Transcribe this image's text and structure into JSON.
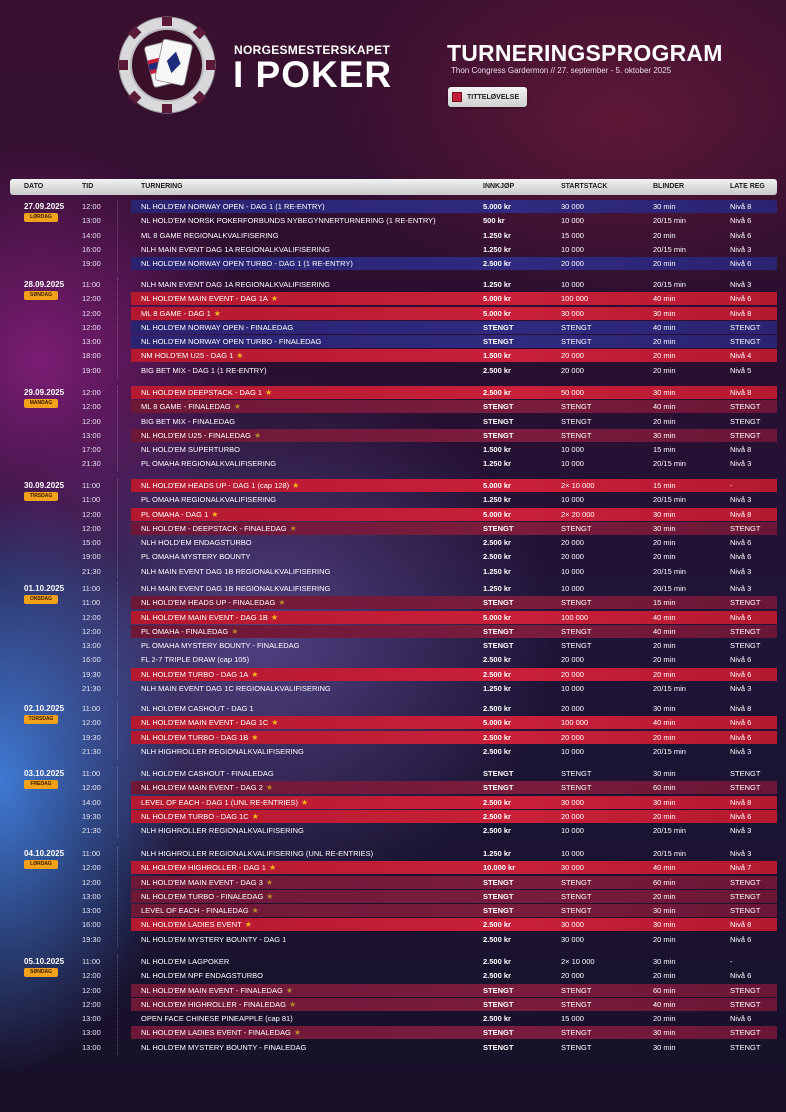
{
  "header": {
    "brand_sub": "NORGESMESTERSKAPET",
    "brand_main": "I POKER",
    "title": "TURNERINGSPROGRAM",
    "subtitle": "Thon Congress Gardermon // 27. september - 5. oktober 2025",
    "legend_label": "TITTELØVELSE"
  },
  "columns": {
    "dato": "DATO",
    "tid": "TID",
    "turnering": "TURNERING",
    "innkjop": "INNKJØP",
    "startstack": "STARTSTACK",
    "blinder": "BLINDER",
    "late_reg": "LATE REG"
  },
  "colors": {
    "title_red": "#c21f3a",
    "title_dark_red": "#7a1c3e",
    "navy": "#2d2678",
    "badge": "#f2a11a",
    "star": "#f5b91c"
  },
  "days": [
    {
      "date": "27.09.2025",
      "weekday": "LØRDAG",
      "rows": [
        {
          "tid": "12:00",
          "turnering": "NL HOLD'EM NORWAY OPEN - DAG 1 (1 RE-ENTRY)",
          "innkjop": "5.000 kr",
          "startstack": "30 000",
          "blinder": "30 min",
          "late_reg": "Nivå 8",
          "style": "navy",
          "star": false
        },
        {
          "tid": "13:00",
          "turnering": "NL HOLD'EM NORSK POKERFORBUNDS NYBEGYNNERTURNERING (1 RE-ENTRY)",
          "innkjop": "500 kr",
          "startstack": "10 000",
          "blinder": "20/15 min",
          "late_reg": "Nivå 6",
          "style": "",
          "star": false
        },
        {
          "tid": "14:00",
          "turnering": "ML 8 GAME REGIONALKVALIFISERING",
          "innkjop": "1.250 kr",
          "startstack": "15 000",
          "blinder": "20 min",
          "late_reg": "Nivå 6",
          "style": "",
          "star": false
        },
        {
          "tid": "16:00",
          "turnering": "NLH MAIN EVENT DAG 1A REGIONALKVALIFISERING",
          "innkjop": "1.250 kr",
          "startstack": "10 000",
          "blinder": "20/15 min",
          "late_reg": "Nivå 3",
          "style": "",
          "star": false
        },
        {
          "tid": "19:00",
          "turnering": "NL HOLD'EM NORWAY OPEN TURBO - DAG 1 (1 RE-ENTRY)",
          "innkjop": "2.500 kr",
          "startstack": "20 000",
          "blinder": "20 min",
          "late_reg": "Nivå 6",
          "style": "navy",
          "star": false
        }
      ]
    },
    {
      "date": "28.09.2025",
      "weekday": "SØNDAG",
      "rows": [
        {
          "tid": "11:00",
          "turnering": "NLH MAIN EVENT DAG 1A REGIONALKVALIFISERING",
          "innkjop": "1.250 kr",
          "startstack": "10 000",
          "blinder": "20/15 min",
          "late_reg": "Nivå 3",
          "style": "",
          "star": false
        },
        {
          "tid": "12:00",
          "turnering": "NL HOLD'EM MAIN EVENT - DAG 1A",
          "innkjop": "5.000 kr",
          "startstack": "100 000",
          "blinder": "40 min",
          "late_reg": "Nivå 6",
          "style": "red",
          "star": true
        },
        {
          "tid": "12:00",
          "turnering": "ML 8 GAME - DAG 1",
          "innkjop": "5.000 kr",
          "startstack": "30 000",
          "blinder": "30 min",
          "late_reg": "Nivå 8",
          "style": "red",
          "star": true
        },
        {
          "tid": "12:00",
          "turnering": "NL HOLD'EM NORWAY OPEN - FINALEDAG",
          "innkjop": "STENGT",
          "startstack": "STENGT",
          "blinder": "40 min",
          "late_reg": "STENGT",
          "style": "navy",
          "star": false
        },
        {
          "tid": "13:00",
          "turnering": "NL HOLD'EM NORWAY OPEN TURBO - FINALEDAG",
          "innkjop": "STENGT",
          "startstack": "STENGT",
          "blinder": "20 min",
          "late_reg": "STENGT",
          "style": "navy",
          "star": false
        },
        {
          "tid": "18:00",
          "turnering": "NM HOLD'EM U25 - DAG 1",
          "innkjop": "1.500 kr",
          "startstack": "20 000",
          "blinder": "20 min",
          "late_reg": "Nivå 4",
          "style": "red",
          "star": true
        },
        {
          "tid": "19:00",
          "turnering": "BIG BET MIX - DAG 1 (1 RE-ENTRY)",
          "innkjop": "2.500 kr",
          "startstack": "20 000",
          "blinder": "20 min",
          "late_reg": "Nivå 5",
          "style": "",
          "star": false
        }
      ]
    },
    {
      "date": "29.09.2025",
      "weekday": "MANDAG",
      "rows": [
        {
          "tid": "12:00",
          "turnering": "NL HOLD'EM DEEPSTACK - DAG 1",
          "innkjop": "2.500 kr",
          "startstack": "50 000",
          "blinder": "30 min",
          "late_reg": "Nivå 8",
          "style": "red",
          "star": true
        },
        {
          "tid": "12:00",
          "turnering": "ML 8 GAME - FINALEDAG",
          "innkjop": "STENGT",
          "startstack": "STENGT",
          "blinder": "40 min",
          "late_reg": "STENGT",
          "style": "dred",
          "star": true
        },
        {
          "tid": "12:00",
          "turnering": "BIG BET MIX - FINALEDAG",
          "innkjop": "STENGT",
          "startstack": "STENGT",
          "blinder": "20 min",
          "late_reg": "STENGT",
          "style": "",
          "star": false
        },
        {
          "tid": "13:00",
          "turnering": "NL HOLD'EM U25 - FINALEDAG",
          "innkjop": "STENGT",
          "startstack": "STENGT",
          "blinder": "30 min",
          "late_reg": "STENGT",
          "style": "dred",
          "star": true
        },
        {
          "tid": "17:00",
          "turnering": "NL HOLD'EM SUPERTURBO",
          "innkjop": "1.500 kr",
          "startstack": "10 000",
          "blinder": "15 min",
          "late_reg": "Nivå 8",
          "style": "",
          "star": false
        },
        {
          "tid": "21:30",
          "turnering": "PL OMAHA REGIONALKVALIFISERING",
          "innkjop": "1.250 kr",
          "startstack": "10 000",
          "blinder": "20/15 min",
          "late_reg": "Nivå 3",
          "style": "",
          "star": false
        }
      ]
    },
    {
      "date": "30.09.2025",
      "weekday": "TIRSDAG",
      "rows": [
        {
          "tid": "11:00",
          "turnering": "NL HOLD'EM HEADS UP - DAG 1 (cap 128)",
          "innkjop": "5.000 kr",
          "startstack": "2× 10 000",
          "blinder": "15 min",
          "late_reg": "-",
          "style": "red",
          "star": true
        },
        {
          "tid": "11:00",
          "turnering": "PL OMAHA REGIONALKVALIFISERING",
          "innkjop": "1.250 kr",
          "startstack": "10 000",
          "blinder": "20/15 min",
          "late_reg": "Nivå 3",
          "style": "",
          "star": false
        },
        {
          "tid": "12:00",
          "turnering": "PL OMAHA - DAG 1",
          "innkjop": "5.000 kr",
          "startstack": "2× 20 000",
          "blinder": "30 min",
          "late_reg": "Nivå 8",
          "style": "red",
          "star": true
        },
        {
          "tid": "12:00",
          "turnering": "NL HOLD'EM - DEEPSTACK - FINALEDAG",
          "innkjop": "STENGT",
          "startstack": "STENGT",
          "blinder": "30 min",
          "late_reg": "STENGT",
          "style": "dred",
          "star": true
        },
        {
          "tid": "15:00",
          "turnering": "NLH HOLD'EM ENDAGSTURBO",
          "innkjop": "2.500 kr",
          "startstack": "20 000",
          "blinder": "20 min",
          "late_reg": "Nivå 6",
          "style": "",
          "star": false
        },
        {
          "tid": "19:00",
          "turnering": "PL OMAHA MYSTERY BOUNTY",
          "innkjop": "2.500 kr",
          "startstack": "20 000",
          "blinder": "20 min",
          "late_reg": "Nivå 6",
          "style": "",
          "star": false
        },
        {
          "tid": "21:30",
          "turnering": "NLH MAIN EVENT DAG 1B REGIONALKVALIFISERING",
          "innkjop": "1.250 kr",
          "startstack": "10 000",
          "blinder": "20/15 min",
          "late_reg": "Nivå 3",
          "style": "",
          "star": false
        }
      ]
    },
    {
      "date": "01.10.2025",
      "weekday": "ONSDAG",
      "rows": [
        {
          "tid": "11:00",
          "turnering": "NLH MAIN EVENT DAG 1B REGIONALKVALIFISERING",
          "innkjop": "1.250 kr",
          "startstack": "10 000",
          "blinder": "20/15 min",
          "late_reg": "Nivå 3",
          "style": "",
          "star": false
        },
        {
          "tid": "11:00",
          "turnering": "NL HOLD'EM HEADS UP - FINALEDAG",
          "innkjop": "STENGT",
          "startstack": "STENGT",
          "blinder": "15 min",
          "late_reg": "STENGT",
          "style": "dred",
          "star": true
        },
        {
          "tid": "12:00",
          "turnering": "NL HOLD'EM MAIN EVENT - DAG 1B",
          "innkjop": "5.000 kr",
          "startstack": "100 000",
          "blinder": "40 min",
          "late_reg": "Nivå 6",
          "style": "red",
          "star": true
        },
        {
          "tid": "12:00",
          "turnering": "PL OMAHA - FINALEDAG",
          "innkjop": "STENGT",
          "startstack": "STENGT",
          "blinder": "40 min",
          "late_reg": "STENGT",
          "style": "dred",
          "star": true
        },
        {
          "tid": "13:00",
          "turnering": "PL OMAHA MYSTERY BOUNTY - FINALEDAG",
          "innkjop": "STENGT",
          "startstack": "STENGT",
          "blinder": "20 min",
          "late_reg": "STENGT",
          "style": "",
          "star": false
        },
        {
          "tid": "16:00",
          "turnering": "FL 2-7 TRIPLE DRAW (cap 105)",
          "innkjop": "2.500 kr",
          "startstack": "20 000",
          "blinder": "20 min",
          "late_reg": "Nivå 6",
          "style": "",
          "star": false
        },
        {
          "tid": "19:30",
          "turnering": "NL HOLD'EM TURBO - DAG 1A",
          "innkjop": "2.500 kr",
          "startstack": "20 000",
          "blinder": "20 min",
          "late_reg": "Nivå 6",
          "style": "red",
          "star": true
        },
        {
          "tid": "21:30",
          "turnering": "NLH MAIN EVENT DAG 1C REGIONALKVALIFISERING",
          "innkjop": "1.250 kr",
          "startstack": "10 000",
          "blinder": "20/15 min",
          "late_reg": "Nivå 3",
          "style": "",
          "star": false
        }
      ]
    },
    {
      "date": "02.10.2025",
      "weekday": "TORSDAG",
      "rows": [
        {
          "tid": "11:00",
          "turnering": "NL HOLD'EM CASHOUT - DAG 1",
          "innkjop": "2.500 kr",
          "startstack": "20 000",
          "blinder": "30 min",
          "late_reg": "Nivå 8",
          "style": "",
          "star": false
        },
        {
          "tid": "12:00",
          "turnering": "NL HOLD'EM MAIN EVENT - DAG 1C",
          "innkjop": "5.000 kr",
          "startstack": "100 000",
          "blinder": "40 min",
          "late_reg": "Nivå 6",
          "style": "red",
          "star": true
        },
        {
          "tid": "19:30",
          "turnering": "NL HOLD'EM TURBO - DAG 1B",
          "innkjop": "2.500 kr",
          "startstack": "20 000",
          "blinder": "20 min",
          "late_reg": "Nivå 6",
          "style": "red",
          "star": true
        },
        {
          "tid": "21:30",
          "turnering": "NLH HIGHROLLER REGIONALKVALIFISERING",
          "innkjop": "2.500 kr",
          "startstack": "10 000",
          "blinder": "20/15 min",
          "late_reg": "Nivå 3",
          "style": "",
          "star": false
        }
      ]
    },
    {
      "date": "03.10.2025",
      "weekday": "FREDAG",
      "rows": [
        {
          "tid": "11:00",
          "turnering": "NL HOLD'EM CASHOUT - FINALEDAG",
          "innkjop": "STENGT",
          "startstack": "STENGT",
          "blinder": "30 min",
          "late_reg": "STENGT",
          "style": "",
          "star": false
        },
        {
          "tid": "12:00",
          "turnering": "NL HOLD'EM MAIN EVENT - DAG 2",
          "innkjop": "STENGT",
          "startstack": "STENGT",
          "blinder": "60 min",
          "late_reg": "STENGT",
          "style": "dred",
          "star": true
        },
        {
          "tid": "14:00",
          "turnering": "LEVEL OF EACH - DAG 1 (UNL RE-ENTRIES)",
          "innkjop": "2.500 kr",
          "startstack": "30 000",
          "blinder": "30 min",
          "late_reg": "Nivå 8",
          "style": "red",
          "star": true
        },
        {
          "tid": "19:30",
          "turnering": "NL HOLD'EM TURBO - DAG 1C",
          "innkjop": "2.500 kr",
          "startstack": "20 000",
          "blinder": "20 min",
          "late_reg": "Nivå 6",
          "style": "red",
          "star": true
        },
        {
          "tid": "21:30",
          "turnering": "NLH HIGHROLLER REGIONALKVALIFISERING",
          "innkjop": "2.500 kr",
          "startstack": "10 000",
          "blinder": "20/15 min",
          "late_reg": "Nivå 3",
          "style": "",
          "star": false
        }
      ]
    },
    {
      "date": "04.10.2025",
      "weekday": "LØRDAG",
      "rows": [
        {
          "tid": "11:00",
          "turnering": "NLH HIGHROLLER REGIONALKVALIFISERING (UNL RE-ENTRIES)",
          "innkjop": "1.250 kr",
          "startstack": "10 000",
          "blinder": "20/15 min",
          "late_reg": "Nivå 3",
          "style": "",
          "star": false
        },
        {
          "tid": "12:00",
          "turnering": "NL HOLD'EM HIGHROLLER - DAG 1",
          "innkjop": "10.000 kr",
          "startstack": "30 000",
          "blinder": "40 min",
          "late_reg": "Nivå 7",
          "style": "red",
          "star": true
        },
        {
          "tid": "12:00",
          "turnering": "NL HOLD'EM MAIN EVENT - DAG 3",
          "innkjop": "STENGT",
          "startstack": "STENGT",
          "blinder": "60 min",
          "late_reg": "STENGT",
          "style": "dred",
          "star": true
        },
        {
          "tid": "13:00",
          "turnering": "NL HOLD'EM TURBO - FINALEDAG",
          "innkjop": "STENGT",
          "startstack": "STENGT",
          "blinder": "20 min",
          "late_reg": "STENGT",
          "style": "dred",
          "star": true
        },
        {
          "tid": "13:00",
          "turnering": "LEVEL OF EACH - FINALEDAG",
          "innkjop": "STENGT",
          "startstack": "STENGT",
          "blinder": "30 min",
          "late_reg": "STENGT",
          "style": "dred",
          "star": true
        },
        {
          "tid": "16:00",
          "turnering": "NL HOLD'EM LADIES EVENT",
          "innkjop": "2.500 kr",
          "startstack": "30 000",
          "blinder": "30 min",
          "late_reg": "Nivå 8",
          "style": "red",
          "star": true
        },
        {
          "tid": "19:30",
          "turnering": "NL HOLD'EM MYSTERY BOUNTY - DAG 1",
          "innkjop": "2.500 kr",
          "startstack": "30 000",
          "blinder": "20 min",
          "late_reg": "Nivå 6",
          "style": "",
          "star": false
        }
      ]
    },
    {
      "date": "05.10.2025",
      "weekday": "SØNDAG",
      "rows": [
        {
          "tid": "11:00",
          "turnering": "NL HOLD'EM LAGPOKER",
          "innkjop": "2.500 kr",
          "startstack": "2× 10 000",
          "blinder": "30 min",
          "late_reg": "-",
          "style": "",
          "star": false
        },
        {
          "tid": "12:00",
          "turnering": "NL HOLD'EM NPF ENDAGSTURBO",
          "innkjop": "2.500 kr",
          "startstack": "20 000",
          "blinder": "20 min",
          "late_reg": "Nivå 6",
          "style": "",
          "star": false
        },
        {
          "tid": "12:00",
          "turnering": "NL HOLD'EM MAIN EVENT - FINALEDAG",
          "innkjop": "STENGT",
          "startstack": "STENGT",
          "blinder": "60 min",
          "late_reg": "STENGT",
          "style": "dred",
          "star": true
        },
        {
          "tid": "12:00",
          "turnering": "NL HOLD'EM HIGHROLLER - FINALEDAG",
          "innkjop": "STENGT",
          "startstack": "STENGT",
          "blinder": "40 min",
          "late_reg": "STENGT",
          "style": "dred",
          "star": true
        },
        {
          "tid": "13:00",
          "turnering": "OPEN FACE CHINESE PINEAPPLE (cap 81)",
          "innkjop": "2.500 kr",
          "startstack": "15 000",
          "blinder": "20 min",
          "late_reg": "Nivå 6",
          "style": "",
          "star": false
        },
        {
          "tid": "13:00",
          "turnering": "NL HOLD'EM LADIES EVENT - FINALEDAG",
          "innkjop": "STENGT",
          "startstack": "STENGT",
          "blinder": "30 min",
          "late_reg": "STENGT",
          "style": "dred",
          "star": true
        },
        {
          "tid": "13:00",
          "turnering": "NL HOLD'EM MYSTERY BOUNTY - FINALEDAG",
          "innkjop": "STENGT",
          "startstack": "STENGT",
          "blinder": "30 min",
          "late_reg": "STENGT",
          "style": "",
          "star": false
        }
      ]
    }
  ]
}
